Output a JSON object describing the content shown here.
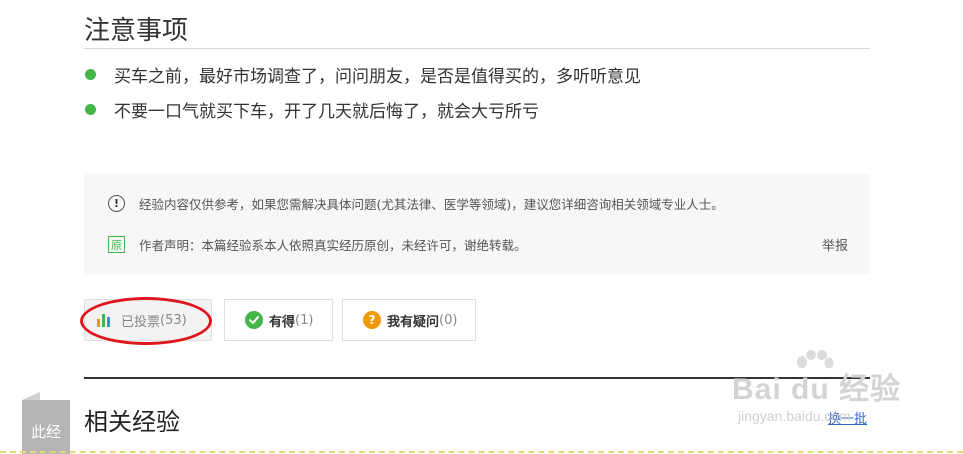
{
  "notes": {
    "title": "注意事项",
    "items": [
      "买车之前，最好市场调查了，问问朋友，是否是值得买的，多听听意见",
      "不要一口气就买下车，开了几天就后悔了，就会大亏所亏"
    ]
  },
  "disclaimer": {
    "notice": "经验内容仅供参考，如果您需解决具体问题(尤其法律、医学等领域)，建议您详细咨询相关领域专业人士。",
    "original_badge": "原",
    "author_statement": "作者声明：本篇经验系本人依照真实经历原创，未经许可，谢绝转载。",
    "report_label": "举报"
  },
  "votes": {
    "voted_label": "已投票",
    "voted_count": "(53)",
    "useful_label": "有得",
    "useful_count": "(1)",
    "question_label": "我有疑问",
    "question_count": "(0)"
  },
  "related": {
    "side_tab": "此经",
    "title": "相关经验",
    "refresh_label": "换一批"
  },
  "watermark": {
    "main": "Bai du 经验",
    "sub": "jingyan.baidu.com"
  },
  "colors": {
    "accent_green": "#44b549",
    "question_orange": "#f39800",
    "annotation_red": "#e0161e",
    "link_blue": "#3366cc"
  }
}
